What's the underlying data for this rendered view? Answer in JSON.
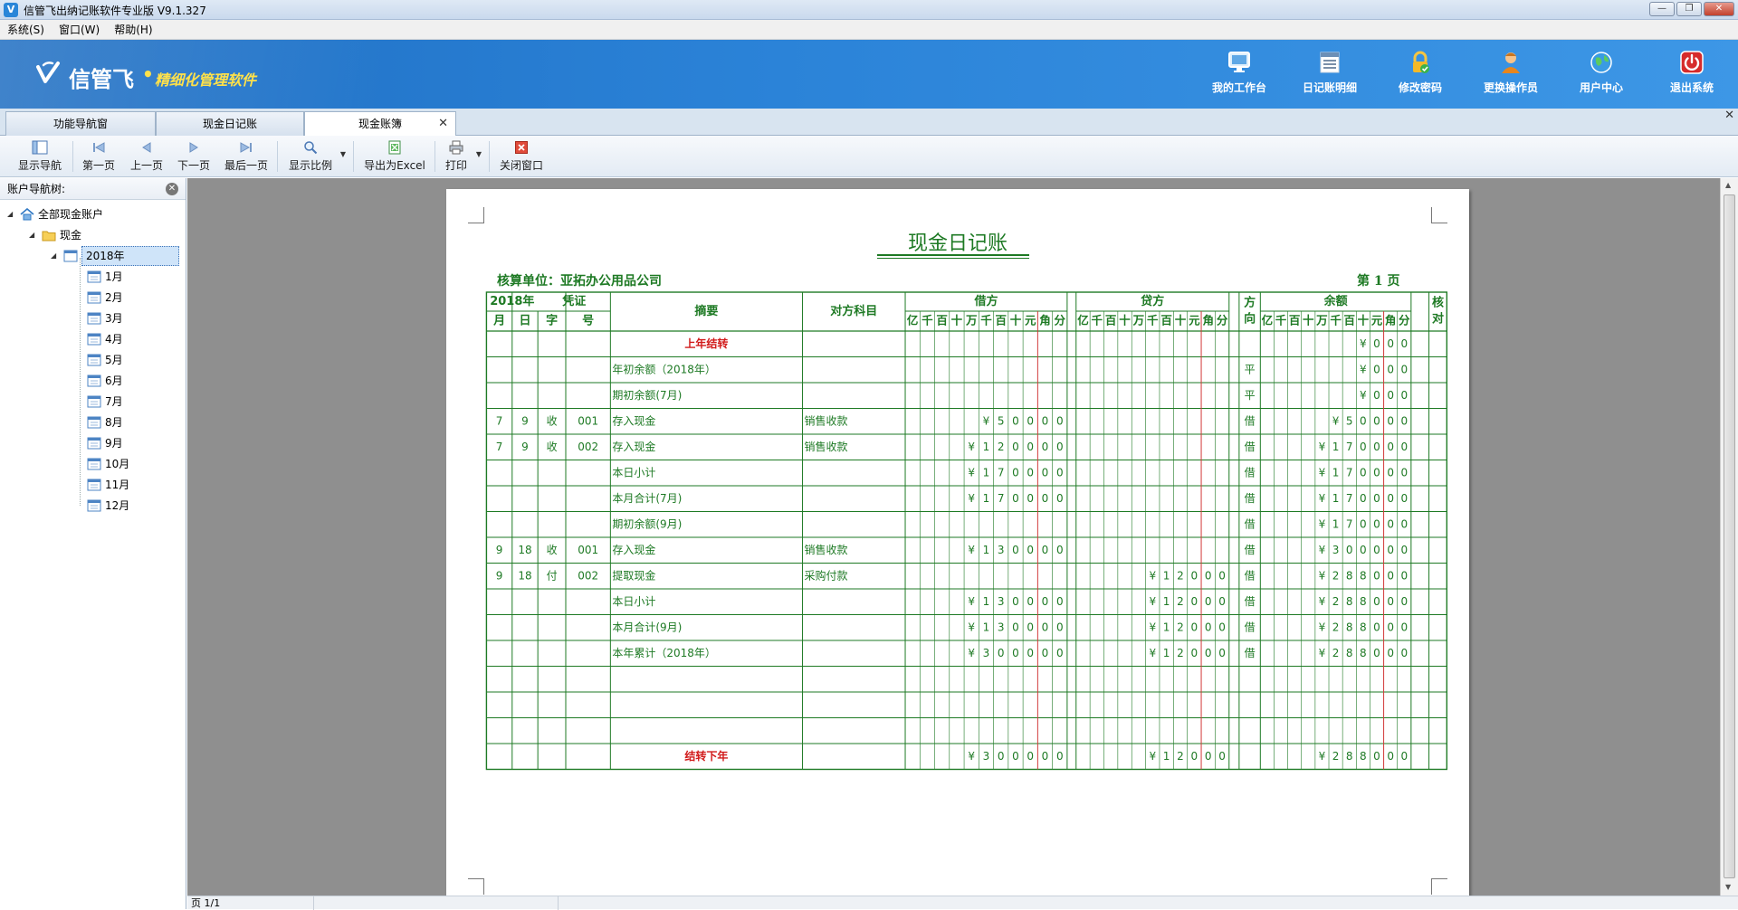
{
  "window": {
    "title": "信管飞出纳记账软件专业版 V9.1.327",
    "buttons": [
      "—",
      "❐",
      "✕"
    ]
  },
  "menu": [
    {
      "label": "系统(S)"
    },
    {
      "label": "窗口(W)"
    },
    {
      "label": "帮助(H)"
    }
  ],
  "banner": {
    "brand": "信管飞",
    "dot": "•",
    "tagline": "精细化管理软件",
    "actions": [
      {
        "label": "我的工作台",
        "icon": "monitor-icon"
      },
      {
        "label": "日记账明细",
        "icon": "ledger-list-icon"
      },
      {
        "label": "修改密码",
        "icon": "lock-icon"
      },
      {
        "label": "更换操作员",
        "icon": "user-icon"
      },
      {
        "label": "用户中心",
        "icon": "globe-icon"
      },
      {
        "label": "退出系统",
        "icon": "power-icon"
      }
    ]
  },
  "tabs": [
    {
      "label": "功能导航窗"
    },
    {
      "label": "现金日记账"
    },
    {
      "label": "现金账簿",
      "active": true,
      "close": "✕"
    }
  ],
  "tabs_close": "✕",
  "toolbar": [
    {
      "label": "显示导航",
      "icon": "navigation-icon"
    },
    {
      "label": "第一页",
      "icon": "first-page-icon"
    },
    {
      "label": "上一页",
      "icon": "prev-page-icon"
    },
    {
      "label": "下一页",
      "icon": "next-page-icon"
    },
    {
      "label": "最后一页",
      "icon": "last-page-icon"
    },
    {
      "label": "显示比例",
      "icon": "zoom-icon"
    },
    {
      "label": "导出为Excel",
      "icon": "excel-icon"
    },
    {
      "label": "打印",
      "icon": "print-icon"
    },
    {
      "label": "关闭窗口",
      "icon": "close-window-icon"
    }
  ],
  "sidebar": {
    "title": "账户导航树:",
    "close": "✕",
    "tree": {
      "root": "全部现金账户",
      "account": "现金",
      "year": "2018年",
      "months": [
        "1月",
        "2月",
        "3月",
        "4月",
        "5月",
        "6月",
        "7月",
        "8月",
        "9月",
        "10月",
        "11月",
        "12月"
      ]
    }
  },
  "status": {
    "page": "页 1/1"
  },
  "ledger": {
    "title": "现金日记账",
    "unit": "核算单位：亚拓办公用品公司",
    "page": "第  1  页",
    "header": {
      "year": "2018年",
      "voucher": "凭证",
      "summary": "摘要",
      "counter_account": "对方科目",
      "debit": "借方",
      "credit": "贷方",
      "direction": [
        "方",
        "向"
      ],
      "balance": "余额",
      "check": [
        "核",
        "对"
      ],
      "month": "月",
      "day": "日",
      "word": "字",
      "number": "号",
      "digits": [
        "亿",
        "千",
        "百",
        "十",
        "万",
        "千",
        "百",
        "十",
        "元",
        "角",
        "分"
      ]
    },
    "rows": [
      {
        "m": "",
        "d": "",
        "w": "",
        "n": "",
        "summary": "上年结转",
        "summary_style": "carry",
        "account": "",
        "debit": "",
        "credit": "",
        "dir": "",
        "balance": "¥000"
      },
      {
        "m": "",
        "d": "",
        "w": "",
        "n": "",
        "summary": "年初余额（2018年）",
        "account": "",
        "debit": "",
        "credit": "",
        "dir": "平",
        "balance": "¥000"
      },
      {
        "m": "",
        "d": "",
        "w": "",
        "n": "",
        "summary": "期初余额(7月)",
        "account": "",
        "debit": "",
        "credit": "",
        "dir": "平",
        "balance": "¥000"
      },
      {
        "m": "7",
        "d": "9",
        "w": "收",
        "n": "001",
        "summary": "存入现金",
        "account": "销售收款",
        "debit": "¥50000",
        "credit": "",
        "dir": "借",
        "balance": "¥50000"
      },
      {
        "m": "7",
        "d": "9",
        "w": "收",
        "n": "002",
        "summary": "存入现金",
        "account": "销售收款",
        "debit": "¥120000",
        "credit": "",
        "dir": "借",
        "balance": "¥170000"
      },
      {
        "m": "",
        "d": "",
        "w": "",
        "n": "",
        "summary": "本日小计",
        "account": "",
        "debit": "¥170000",
        "credit": "",
        "dir": "借",
        "balance": "¥170000"
      },
      {
        "m": "",
        "d": "",
        "w": "",
        "n": "",
        "summary": "本月合计(7月)",
        "account": "",
        "debit": "¥170000",
        "credit": "",
        "dir": "借",
        "balance": "¥170000"
      },
      {
        "m": "",
        "d": "",
        "w": "",
        "n": "",
        "summary": "期初余额(9月)",
        "account": "",
        "debit": "",
        "credit": "",
        "dir": "借",
        "balance": "¥170000"
      },
      {
        "m": "9",
        "d": "18",
        "w": "收",
        "n": "001",
        "summary": "存入现金",
        "account": "销售收款",
        "debit": "¥130000",
        "credit": "",
        "dir": "借",
        "balance": "¥300000"
      },
      {
        "m": "9",
        "d": "18",
        "w": "付",
        "n": "002",
        "summary": "提取现金",
        "account": "采购付款",
        "debit": "",
        "credit": "¥12000",
        "dir": "借",
        "balance": "¥288000"
      },
      {
        "m": "",
        "d": "",
        "w": "",
        "n": "",
        "summary": "本日小计",
        "account": "",
        "debit": "¥130000",
        "credit": "¥12000",
        "dir": "借",
        "balance": "¥288000"
      },
      {
        "m": "",
        "d": "",
        "w": "",
        "n": "",
        "summary": "本月合计(9月)",
        "account": "",
        "debit": "¥130000",
        "credit": "¥12000",
        "dir": "借",
        "balance": "¥288000"
      },
      {
        "m": "",
        "d": "",
        "w": "",
        "n": "",
        "summary": "本年累计（2018年）",
        "account": "",
        "debit": "¥300000",
        "credit": "¥12000",
        "dir": "借",
        "balance": "¥288000"
      },
      {
        "m": "",
        "d": "",
        "w": "",
        "n": "",
        "summary": "",
        "account": "",
        "debit": "",
        "credit": "",
        "dir": "",
        "balance": ""
      },
      {
        "m": "",
        "d": "",
        "w": "",
        "n": "",
        "summary": "",
        "account": "",
        "debit": "",
        "credit": "",
        "dir": "",
        "balance": ""
      },
      {
        "m": "",
        "d": "",
        "w": "",
        "n": "",
        "summary": "",
        "account": "",
        "debit": "",
        "credit": "",
        "dir": "",
        "balance": ""
      },
      {
        "m": "",
        "d": "",
        "w": "",
        "n": "",
        "summary": "结转下年",
        "summary_style": "carry",
        "account": "",
        "debit": "¥300000",
        "credit": "¥12000",
        "dir": "",
        "balance": "¥288000"
      }
    ],
    "colors": {
      "ink": "#1e7a24",
      "carry_text": "#d11a1a",
      "yuan_divider": "#d23a3a"
    }
  }
}
